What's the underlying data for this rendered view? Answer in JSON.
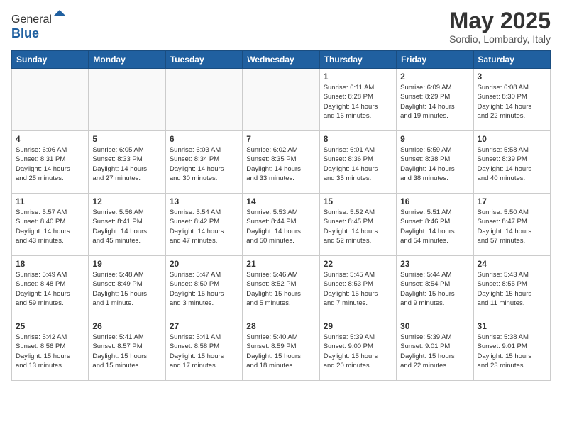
{
  "header": {
    "logo_general": "General",
    "logo_blue": "Blue",
    "month_title": "May 2025",
    "location": "Sordio, Lombardy, Italy"
  },
  "weekdays": [
    "Sunday",
    "Monday",
    "Tuesday",
    "Wednesday",
    "Thursday",
    "Friday",
    "Saturday"
  ],
  "weeks": [
    [
      {
        "day": "",
        "info": ""
      },
      {
        "day": "",
        "info": ""
      },
      {
        "day": "",
        "info": ""
      },
      {
        "day": "",
        "info": ""
      },
      {
        "day": "1",
        "info": "Sunrise: 6:11 AM\nSunset: 8:28 PM\nDaylight: 14 hours\nand 16 minutes."
      },
      {
        "day": "2",
        "info": "Sunrise: 6:09 AM\nSunset: 8:29 PM\nDaylight: 14 hours\nand 19 minutes."
      },
      {
        "day": "3",
        "info": "Sunrise: 6:08 AM\nSunset: 8:30 PM\nDaylight: 14 hours\nand 22 minutes."
      }
    ],
    [
      {
        "day": "4",
        "info": "Sunrise: 6:06 AM\nSunset: 8:31 PM\nDaylight: 14 hours\nand 25 minutes."
      },
      {
        "day": "5",
        "info": "Sunrise: 6:05 AM\nSunset: 8:33 PM\nDaylight: 14 hours\nand 27 minutes."
      },
      {
        "day": "6",
        "info": "Sunrise: 6:03 AM\nSunset: 8:34 PM\nDaylight: 14 hours\nand 30 minutes."
      },
      {
        "day": "7",
        "info": "Sunrise: 6:02 AM\nSunset: 8:35 PM\nDaylight: 14 hours\nand 33 minutes."
      },
      {
        "day": "8",
        "info": "Sunrise: 6:01 AM\nSunset: 8:36 PM\nDaylight: 14 hours\nand 35 minutes."
      },
      {
        "day": "9",
        "info": "Sunrise: 5:59 AM\nSunset: 8:38 PM\nDaylight: 14 hours\nand 38 minutes."
      },
      {
        "day": "10",
        "info": "Sunrise: 5:58 AM\nSunset: 8:39 PM\nDaylight: 14 hours\nand 40 minutes."
      }
    ],
    [
      {
        "day": "11",
        "info": "Sunrise: 5:57 AM\nSunset: 8:40 PM\nDaylight: 14 hours\nand 43 minutes."
      },
      {
        "day": "12",
        "info": "Sunrise: 5:56 AM\nSunset: 8:41 PM\nDaylight: 14 hours\nand 45 minutes."
      },
      {
        "day": "13",
        "info": "Sunrise: 5:54 AM\nSunset: 8:42 PM\nDaylight: 14 hours\nand 47 minutes."
      },
      {
        "day": "14",
        "info": "Sunrise: 5:53 AM\nSunset: 8:44 PM\nDaylight: 14 hours\nand 50 minutes."
      },
      {
        "day": "15",
        "info": "Sunrise: 5:52 AM\nSunset: 8:45 PM\nDaylight: 14 hours\nand 52 minutes."
      },
      {
        "day": "16",
        "info": "Sunrise: 5:51 AM\nSunset: 8:46 PM\nDaylight: 14 hours\nand 54 minutes."
      },
      {
        "day": "17",
        "info": "Sunrise: 5:50 AM\nSunset: 8:47 PM\nDaylight: 14 hours\nand 57 minutes."
      }
    ],
    [
      {
        "day": "18",
        "info": "Sunrise: 5:49 AM\nSunset: 8:48 PM\nDaylight: 14 hours\nand 59 minutes."
      },
      {
        "day": "19",
        "info": "Sunrise: 5:48 AM\nSunset: 8:49 PM\nDaylight: 15 hours\nand 1 minute."
      },
      {
        "day": "20",
        "info": "Sunrise: 5:47 AM\nSunset: 8:50 PM\nDaylight: 15 hours\nand 3 minutes."
      },
      {
        "day": "21",
        "info": "Sunrise: 5:46 AM\nSunset: 8:52 PM\nDaylight: 15 hours\nand 5 minutes."
      },
      {
        "day": "22",
        "info": "Sunrise: 5:45 AM\nSunset: 8:53 PM\nDaylight: 15 hours\nand 7 minutes."
      },
      {
        "day": "23",
        "info": "Sunrise: 5:44 AM\nSunset: 8:54 PM\nDaylight: 15 hours\nand 9 minutes."
      },
      {
        "day": "24",
        "info": "Sunrise: 5:43 AM\nSunset: 8:55 PM\nDaylight: 15 hours\nand 11 minutes."
      }
    ],
    [
      {
        "day": "25",
        "info": "Sunrise: 5:42 AM\nSunset: 8:56 PM\nDaylight: 15 hours\nand 13 minutes."
      },
      {
        "day": "26",
        "info": "Sunrise: 5:41 AM\nSunset: 8:57 PM\nDaylight: 15 hours\nand 15 minutes."
      },
      {
        "day": "27",
        "info": "Sunrise: 5:41 AM\nSunset: 8:58 PM\nDaylight: 15 hours\nand 17 minutes."
      },
      {
        "day": "28",
        "info": "Sunrise: 5:40 AM\nSunset: 8:59 PM\nDaylight: 15 hours\nand 18 minutes."
      },
      {
        "day": "29",
        "info": "Sunrise: 5:39 AM\nSunset: 9:00 PM\nDaylight: 15 hours\nand 20 minutes."
      },
      {
        "day": "30",
        "info": "Sunrise: 5:39 AM\nSunset: 9:01 PM\nDaylight: 15 hours\nand 22 minutes."
      },
      {
        "day": "31",
        "info": "Sunrise: 5:38 AM\nSunset: 9:01 PM\nDaylight: 15 hours\nand 23 minutes."
      }
    ]
  ]
}
